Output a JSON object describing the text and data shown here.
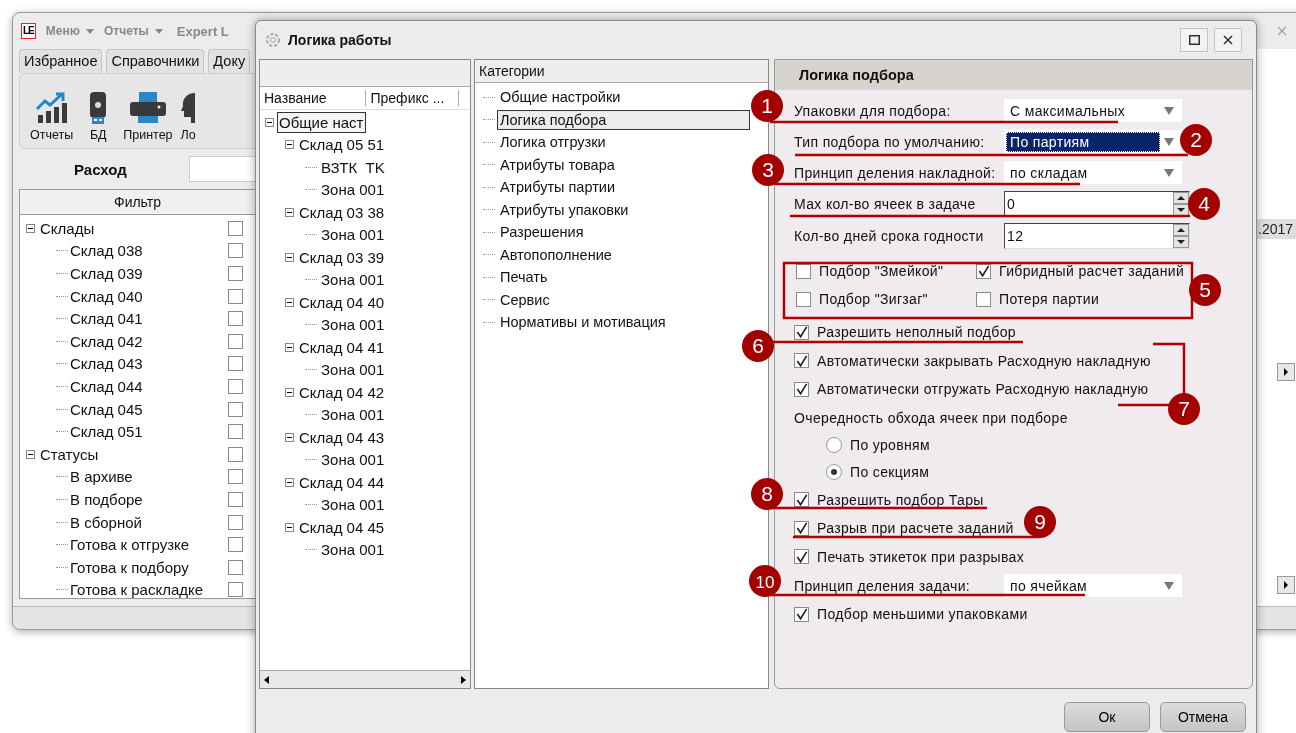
{
  "main_window": {
    "logo": "LE",
    "menu": [
      "Меню",
      "Отчеты"
    ],
    "title": "Expert L",
    "tabs": [
      {
        "label": "Избранное",
        "selected": false
      },
      {
        "label": "Справочники",
        "selected": false
      },
      {
        "label": "Доку",
        "selected": false
      }
    ],
    "toolbar": [
      {
        "kind": "chart",
        "label": "Отчеты"
      },
      {
        "kind": "drive",
        "label": "БД"
      },
      {
        "kind": "printer",
        "label": "Принтер"
      },
      {
        "kind": "head",
        "label": "Ло"
      }
    ],
    "section_title": "Расход",
    "filter": {
      "header": "Фильтр",
      "tree": [
        {
          "label": "Склады",
          "expanded": true,
          "checked": false,
          "children": [
            {
              "label": "Склад 038",
              "checked": false
            },
            {
              "label": "Склад 039",
              "checked": false
            },
            {
              "label": "Склад 040",
              "checked": false
            },
            {
              "label": "Склад 041",
              "checked": false
            },
            {
              "label": "Склад 042",
              "checked": false
            },
            {
              "label": "Склад 043",
              "checked": false
            },
            {
              "label": "Склад 044",
              "checked": false
            },
            {
              "label": "Склад 045",
              "checked": false
            },
            {
              "label": "Склад 051",
              "checked": false
            }
          ]
        },
        {
          "label": "Статусы",
          "expanded": true,
          "checked": false,
          "children": [
            {
              "label": "В архиве",
              "checked": false
            },
            {
              "label": "В подборе",
              "checked": false
            },
            {
              "label": "В сборной",
              "checked": false
            },
            {
              "label": "Готова к отгрузке",
              "checked": false
            },
            {
              "label": "Готова к подбору",
              "checked": false
            },
            {
              "label": "Готова к раскладке",
              "checked": false
            }
          ]
        }
      ]
    },
    "date_fragment": ".2017"
  },
  "dialog": {
    "title": "Логика работы",
    "tree_columns": [
      "Название",
      "Префикс ..."
    ],
    "tree": [
      {
        "label": "Общие наст",
        "selected": true,
        "expanded": true,
        "children": [
          {
            "label": "Склад 05 51",
            "selected": false,
            "expanded": true,
            "children": [
              {
                "label": "ВЗТК  TK",
                "selected": false
              },
              {
                "label": "Зона 001",
                "selected": false
              }
            ]
          },
          {
            "label": "Склад 03 38",
            "selected": false,
            "expanded": true,
            "children": [
              {
                "label": "Зона 001",
                "selected": false
              }
            ]
          },
          {
            "label": "Склад 03 39",
            "selected": false,
            "expanded": true,
            "children": [
              {
                "label": "Зона 001",
                "selected": false
              }
            ]
          },
          {
            "label": "Склад 04 40",
            "selected": false,
            "expanded": true,
            "children": [
              {
                "label": "Зона 001",
                "selected": false
              }
            ]
          },
          {
            "label": "Склад 04 41",
            "selected": false,
            "expanded": true,
            "children": [
              {
                "label": "Зона 001",
                "selected": false
              }
            ]
          },
          {
            "label": "Склад 04 42",
            "selected": false,
            "expanded": true,
            "children": [
              {
                "label": "Зона 001",
                "selected": false
              }
            ]
          },
          {
            "label": "Склад 04 43",
            "selected": false,
            "expanded": true,
            "children": [
              {
                "label": "Зона 001",
                "selected": false
              }
            ]
          },
          {
            "label": "Склад 04 44",
            "selected": false,
            "expanded": true,
            "children": [
              {
                "label": "Зона 001",
                "selected": false
              }
            ]
          },
          {
            "label": "Склад 04 45",
            "selected": false,
            "expanded": true,
            "children": [
              {
                "label": "Зона 001",
                "selected": false
              }
            ]
          }
        ]
      }
    ],
    "categories": {
      "header": "Категории",
      "items": [
        {
          "label": "Общие настройки",
          "selected": false
        },
        {
          "label": "Логика подбора",
          "selected": true
        },
        {
          "label": "Логика отгрузки",
          "selected": false
        },
        {
          "label": "Атрибуты товара",
          "selected": false
        },
        {
          "label": "Атрибуты партии",
          "selected": false
        },
        {
          "label": "Атрибуты упаковки",
          "selected": false
        },
        {
          "label": "Разрешения",
          "selected": false
        },
        {
          "label": "Автопополнение",
          "selected": false
        },
        {
          "label": "Печать",
          "selected": false
        },
        {
          "label": "Сервис",
          "selected": false
        },
        {
          "label": "Нормативы и мотивация",
          "selected": false
        }
      ]
    },
    "settings": {
      "title": "Логика подбора",
      "rows": [
        {
          "kind": "select",
          "label": "Упаковки для подбора:",
          "value": "С максимальных",
          "focused": false
        },
        {
          "kind": "select",
          "label": "Тип подбора по умолчанию:",
          "value": "По партиям",
          "focused": true
        },
        {
          "kind": "select",
          "label": "Принцип деления накладной:",
          "value": "по складам",
          "focused": false
        },
        {
          "kind": "spin",
          "label": "Мах кол-во ячеек в задаче",
          "value": "0"
        },
        {
          "kind": "spin",
          "label": "Кол-во дней срока годности",
          "value": "12"
        },
        {
          "kind": "group",
          "items": [
            {
              "label": "Подбор \"Змейкой\"",
              "checked": false
            },
            {
              "label": "Гибридный расчет заданий",
              "checked": true
            },
            {
              "label": "Подбор \"Зигзаг\"",
              "checked": false
            },
            {
              "label": "Потеря партии",
              "checked": false
            }
          ]
        },
        {
          "kind": "check",
          "label": "Разрешить неполный подбор",
          "checked": true
        },
        {
          "kind": "check",
          "label": "Автоматически закрывать Расходную накладную",
          "checked": true
        },
        {
          "kind": "check",
          "label": "Автоматически отгружать Расходную накладную",
          "checked": true
        },
        {
          "kind": "heading",
          "label": "Очередность обхода ячеек при подборе"
        },
        {
          "kind": "radio",
          "label": "По уровням",
          "selected": false
        },
        {
          "kind": "radio",
          "label": "По секциям",
          "selected": true
        },
        {
          "kind": "check",
          "label": "Разрешить подбор Тары",
          "checked": true
        },
        {
          "kind": "check",
          "label": "Разрыв при расчете заданий",
          "checked": true
        },
        {
          "kind": "check",
          "label": "Печать этикеток при разрывах",
          "checked": true
        },
        {
          "kind": "select",
          "label": "Принцип деления задачи:",
          "value": "по ячейкам",
          "focused": false
        },
        {
          "kind": "check",
          "label": "Подбор меньшими упаковками",
          "checked": true
        }
      ]
    },
    "buttons": [
      "Ок",
      "Отмена"
    ]
  },
  "annotations": [
    "1",
    "2",
    "3",
    "4",
    "5",
    "6",
    "7",
    "8",
    "9",
    "10"
  ]
}
